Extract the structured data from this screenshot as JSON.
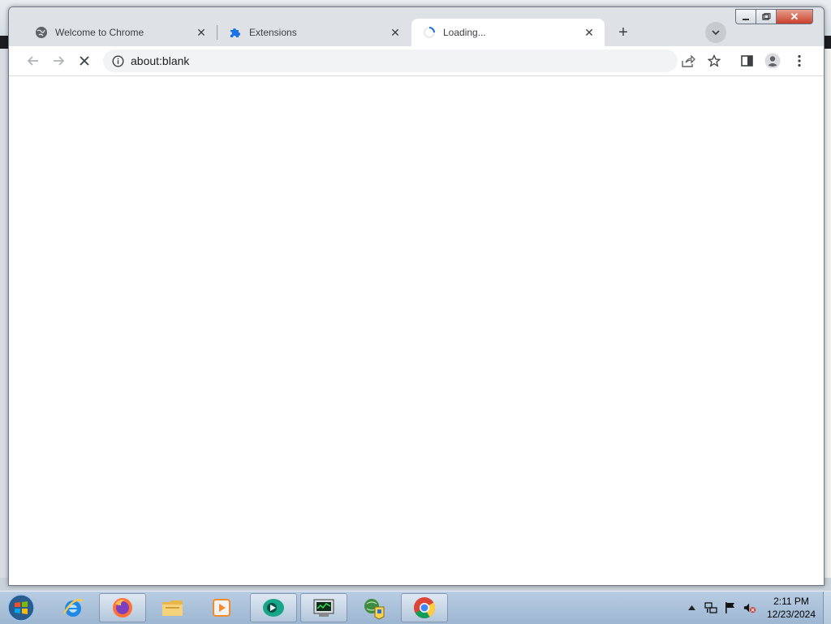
{
  "browser": {
    "tabs": [
      {
        "title": "Welcome to Chrome",
        "icon": "globe-icon",
        "active": false
      },
      {
        "title": "Extensions",
        "icon": "puzzle-icon",
        "active": false
      },
      {
        "title": "Loading...",
        "icon": "loading-spinner-icon",
        "active": true
      }
    ],
    "new_tab_label": "+",
    "address": "about:blank",
    "accent_color": "#1a73e8"
  },
  "taskbar": {
    "apps": [
      {
        "name": "internet-explorer-icon",
        "open": false
      },
      {
        "name": "firefox-icon",
        "open": true
      },
      {
        "name": "file-explorer-icon",
        "open": false
      },
      {
        "name": "media-player-icon",
        "open": false
      },
      {
        "name": "chat-app-icon",
        "open": true
      },
      {
        "name": "task-manager-icon",
        "open": true
      },
      {
        "name": "network-tool-icon",
        "open": false
      },
      {
        "name": "chrome-icon",
        "open": true
      }
    ],
    "clock": {
      "time": "2:11 PM",
      "date": "12/23/2024"
    }
  }
}
